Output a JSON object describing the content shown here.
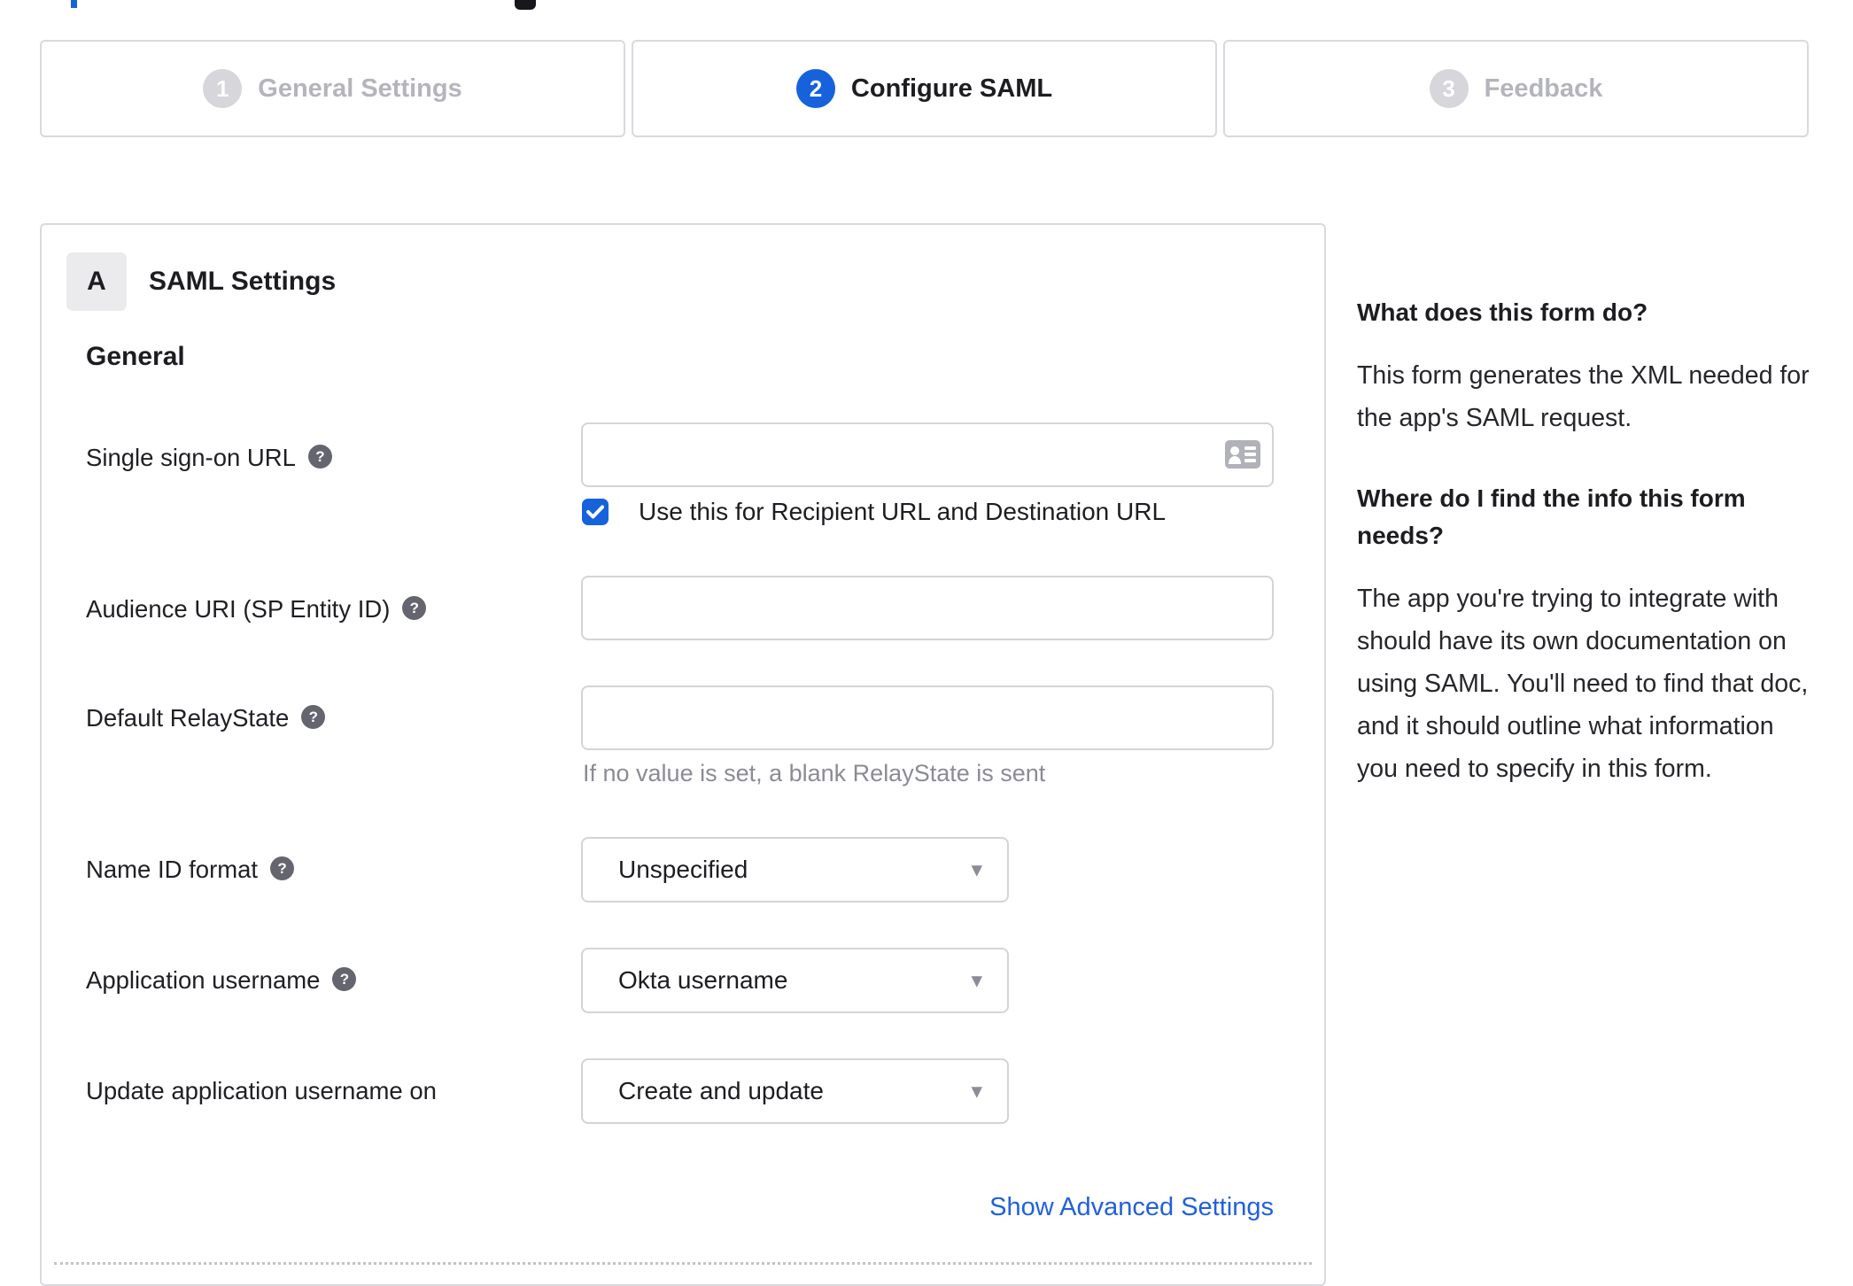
{
  "stepper": {
    "steps": [
      {
        "number": "1",
        "label": "General Settings",
        "state": "inactive"
      },
      {
        "number": "2",
        "label": "Configure SAML",
        "state": "active"
      },
      {
        "number": "3",
        "label": "Feedback",
        "state": "inactive"
      }
    ]
  },
  "panel": {
    "section_badge": "A",
    "section_title": "SAML Settings",
    "group_title": "General",
    "fields": [
      {
        "label": "Single sign-on URL",
        "type": "text",
        "value": "",
        "has_help": true
      },
      {
        "label": "Audience URI (SP Entity ID)",
        "type": "text",
        "value": "",
        "has_help": true
      },
      {
        "label": "Default RelayState",
        "type": "text",
        "value": "",
        "has_help": true,
        "hint": "If no value is set, a blank RelayState is sent"
      },
      {
        "label": "Name ID format",
        "type": "select",
        "value": "Unspecified",
        "has_help": true
      },
      {
        "label": "Application username",
        "type": "select",
        "value": "Okta username",
        "has_help": true
      },
      {
        "label": "Update application username on",
        "type": "select",
        "value": "Create and update",
        "has_help": false
      }
    ],
    "checkbox": {
      "checked": true,
      "label": "Use this for Recipient URL and Destination URL"
    },
    "advanced_link": "Show Advanced Settings"
  },
  "sidebar": {
    "sections": [
      {
        "heading": "What does this form do?",
        "body": "This form generates the XML needed for the app's SAML request."
      },
      {
        "heading": "Where do I find the info this form needs?",
        "body": "The app you're trying to integrate with should have its own documentation on using SAML. You'll need to find that doc, and it should outline what information you need to specify in this form."
      }
    ]
  },
  "icons": {
    "help": "?",
    "caret": "▾"
  },
  "colors": {
    "accent_blue": "#1662dd",
    "link_blue": "#2160dd",
    "border_gray": "#d9d9de",
    "inactive_gray": "#b4b4bc",
    "hint_gray": "#8b8b93",
    "text_dark": "#1d1d21"
  }
}
